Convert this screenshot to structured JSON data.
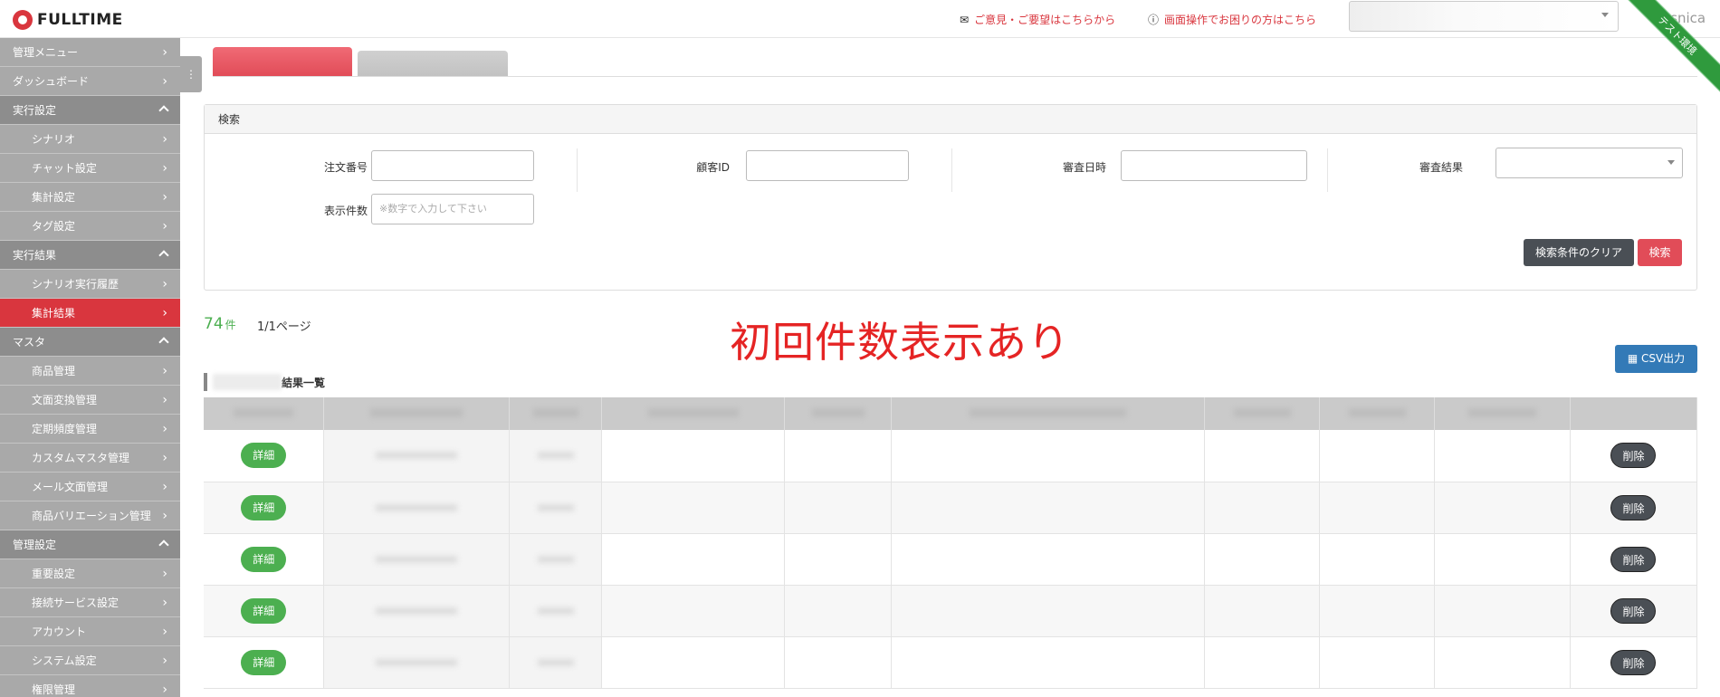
{
  "brand": {
    "name": "FULLTIME"
  },
  "header": {
    "link_feedback": "ご意見・ご要望はこちらから",
    "link_help": "画面操作でお困りの方はこちら",
    "username": "asnica",
    "ribbon": "テスト環境"
  },
  "sidebar": {
    "toggle_icon": "⋮",
    "items": [
      {
        "label": "管理メニュー",
        "type": "item"
      },
      {
        "label": "ダッシュボード",
        "type": "item"
      },
      {
        "label": "実行設定",
        "type": "section"
      },
      {
        "label": "シナリオ",
        "type": "sub"
      },
      {
        "label": "チャット設定",
        "type": "sub"
      },
      {
        "label": "集計設定",
        "type": "sub"
      },
      {
        "label": "タグ設定",
        "type": "sub"
      },
      {
        "label": "実行結果",
        "type": "section"
      },
      {
        "label": "シナリオ実行履歴",
        "type": "sub"
      },
      {
        "label": "集計結果",
        "type": "sub-active"
      },
      {
        "label": "マスタ",
        "type": "section"
      },
      {
        "label": "商品管理",
        "type": "sub"
      },
      {
        "label": "文面変換管理",
        "type": "sub"
      },
      {
        "label": "定期頻度管理",
        "type": "sub"
      },
      {
        "label": "カスタムマスタ管理",
        "type": "sub"
      },
      {
        "label": "メール文面管理",
        "type": "sub"
      },
      {
        "label": "商品バリエーション管理",
        "type": "sub"
      },
      {
        "label": "管理設定",
        "type": "section"
      },
      {
        "label": "重要設定",
        "type": "sub"
      },
      {
        "label": "接続サービス設定",
        "type": "sub"
      },
      {
        "label": "アカウント",
        "type": "sub"
      },
      {
        "label": "システム設定",
        "type": "sub"
      },
      {
        "label": "権限管理",
        "type": "sub"
      }
    ]
  },
  "search": {
    "title": "検索",
    "order_no_label": "注文番号",
    "customer_id_label": "顧客ID",
    "review_date_label": "審査日時",
    "review_result_label": "審査結果",
    "display_count_label": "表示件数",
    "display_count_placeholder": "※数字で入力して下さい",
    "clear_button": "検索条件のクリア",
    "search_button": "検索"
  },
  "results": {
    "count": "74",
    "count_unit": "件",
    "page_current": "1",
    "page_suffix": "/1ページ",
    "annotation": "初回件数表示あり",
    "csv_button": "▦ CSV出力",
    "list_title": "結果一覧",
    "detail_label": "詳細",
    "delete_label": "削除",
    "row_count": 5
  },
  "colors": {
    "accent": "#d9363e",
    "sidebar": "#a9a9a9",
    "success": "#4caf50",
    "primary": "#337ab7"
  }
}
